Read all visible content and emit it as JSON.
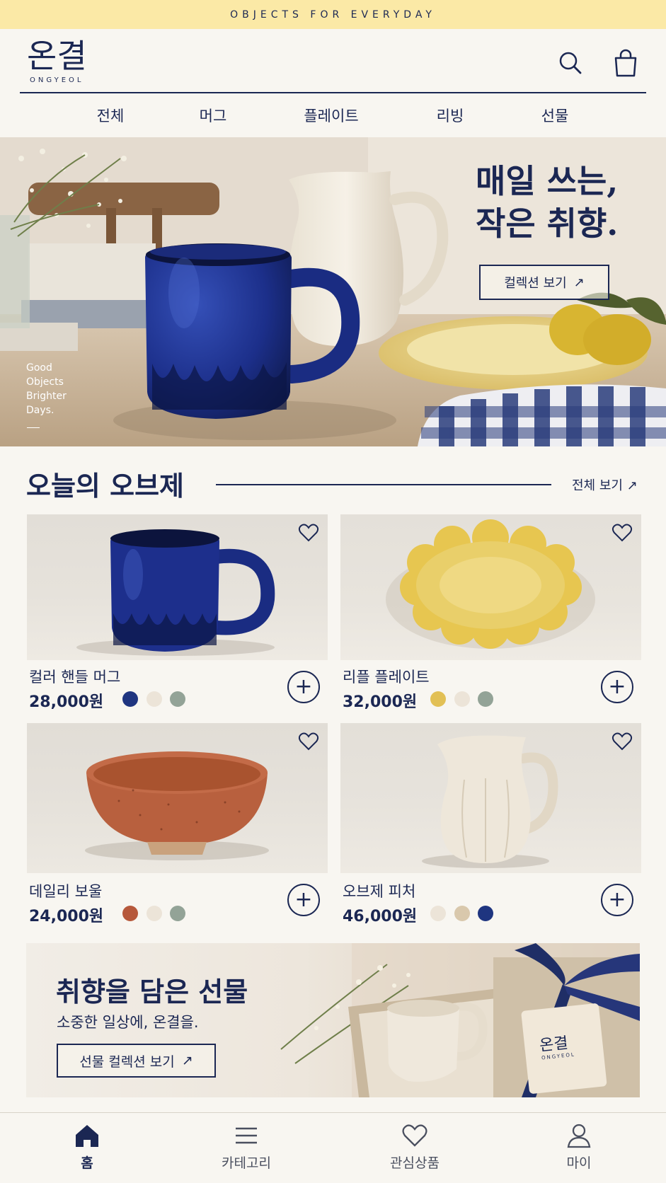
{
  "topbar": {
    "text": "OBJECTS FOR EVERYDAY"
  },
  "header": {
    "logo_ko": "온결",
    "logo_en": "ONGYEOL",
    "icons": [
      "search-icon",
      "shopping-bag-icon"
    ]
  },
  "nav": {
    "items": [
      {
        "label": "전체"
      },
      {
        "label": "머그"
      },
      {
        "label": "플레이트"
      },
      {
        "label": "리빙"
      },
      {
        "label": "선물"
      }
    ]
  },
  "hero": {
    "title_line1": "매일 쓰는,",
    "title_line2": "작은 취향.",
    "button": "컬렉션 보기",
    "side_lines": [
      "Good",
      "Objects",
      "Brighter",
      "Days."
    ]
  },
  "section": {
    "title": "오늘의 오브제",
    "link": "전체 보기"
  },
  "products": [
    {
      "name": "컬러 핸들 머그",
      "price": "28,000원",
      "swatches": [
        "#1f3580",
        "#ece4d8",
        "#93a397"
      ]
    },
    {
      "name": "리플 플레이트",
      "price": "32,000원",
      "swatches": [
        "#e2c055",
        "#ece4d8",
        "#93a397"
      ]
    },
    {
      "name": "데일리 보울",
      "price": "24,000원",
      "swatches": [
        "#b6583b",
        "#ece4d8",
        "#93a397"
      ]
    },
    {
      "name": "오브제 피처",
      "price": "46,000원",
      "swatches": [
        "#ece4d8",
        "#d9c8ac",
        "#1f3580"
      ]
    }
  ],
  "banner": {
    "title": "취향을 담은 선물",
    "subtitle": "소중한 일상에, 온결을.",
    "button": "선물 컬렉션 보기",
    "tag_ko": "온결",
    "tag_en": "ONGYEOL"
  },
  "bottom_nav": {
    "items": [
      {
        "label": "홈",
        "icon": "home-icon",
        "active": true
      },
      {
        "label": "카테고리",
        "icon": "menu-icon",
        "active": false
      },
      {
        "label": "관심상품",
        "icon": "heart-icon",
        "active": false
      },
      {
        "label": "마이",
        "icon": "user-icon",
        "active": false
      }
    ]
  },
  "colors": {
    "navy": "#1b2753",
    "cream": "#f8f6f1",
    "topbar": "#fbe9a6"
  }
}
